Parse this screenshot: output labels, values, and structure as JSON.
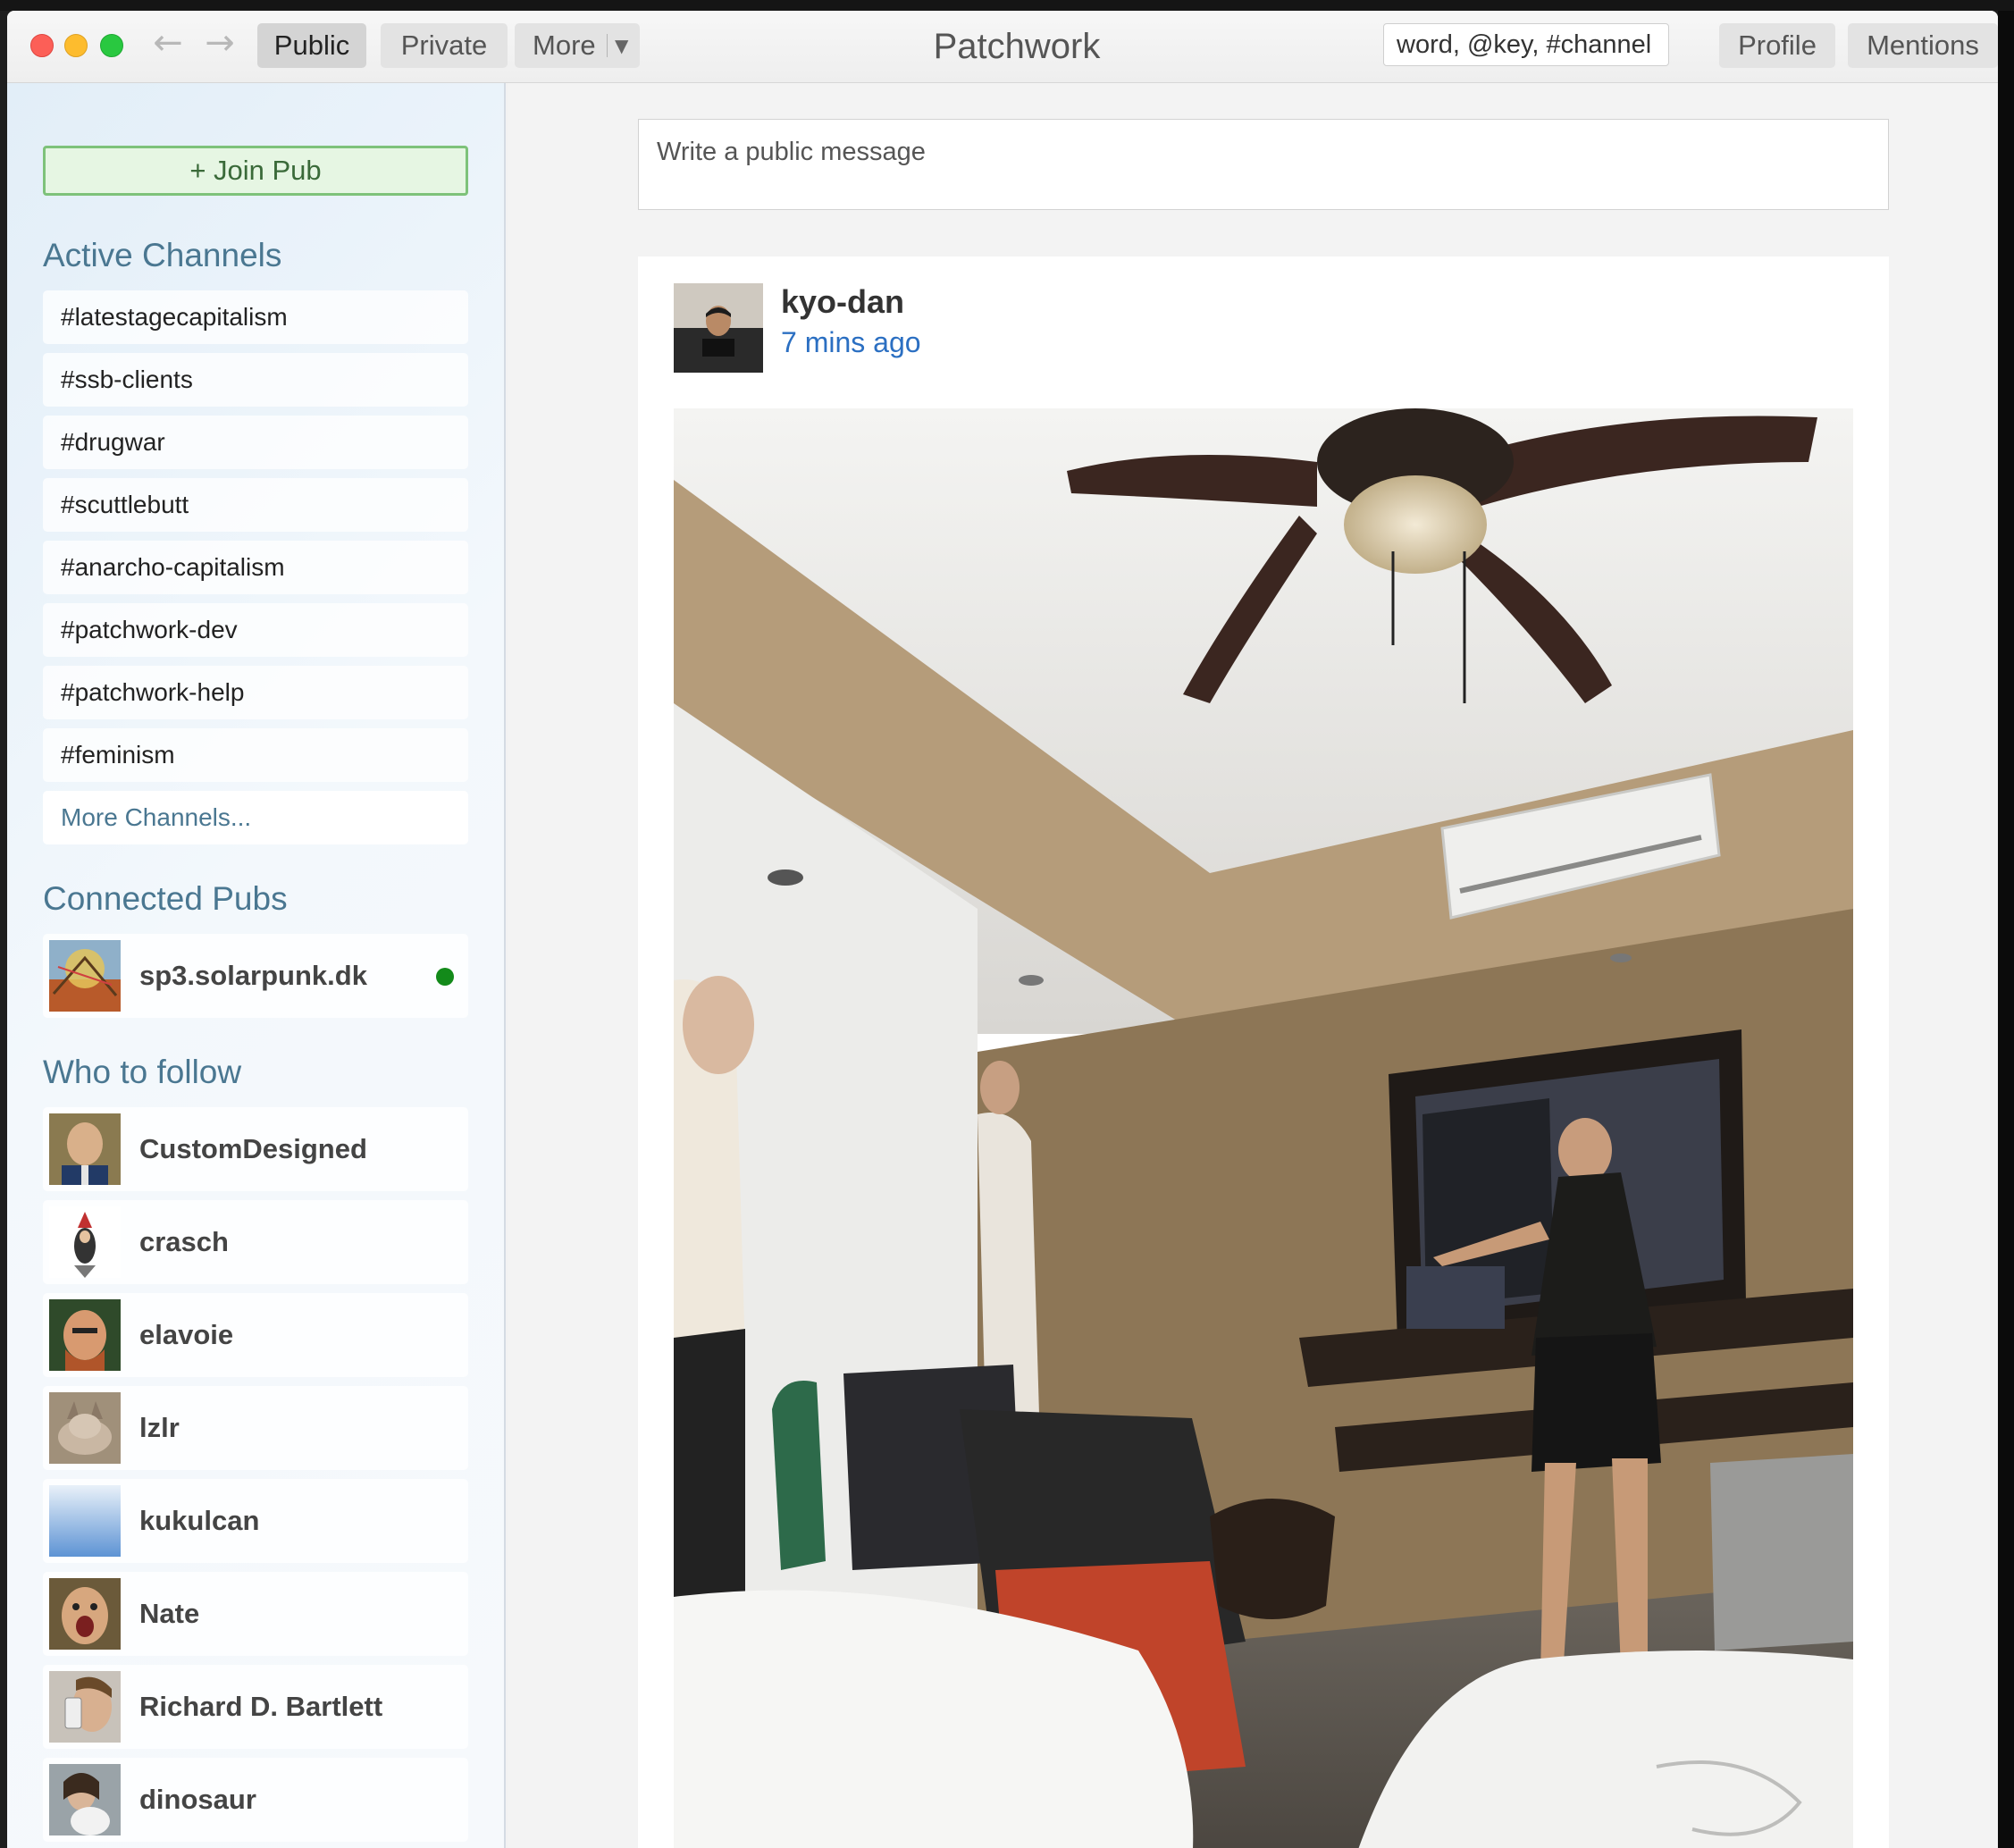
{
  "window": {
    "title": "Patchwork"
  },
  "toolbar": {
    "public_label": "Public",
    "private_label": "Private",
    "more_label": "More",
    "search_placeholder": "word, @key, #channel",
    "profile_label": "Profile",
    "mentions_label": "Mentions"
  },
  "sidebar": {
    "join_pub_label": "+ Join Pub",
    "active_channels_title": "Active Channels",
    "channels": [
      "#latestagecapitalism",
      "#ssb-clients",
      "#drugwar",
      "#scuttlebutt",
      "#anarcho-capitalism",
      "#patchwork-dev",
      "#patchwork-help",
      "#feminism"
    ],
    "more_channels_label": "More Channels...",
    "connected_pubs_title": "Connected Pubs",
    "pubs": [
      {
        "name": "sp3.solarpunk.dk",
        "status_color": "#138a1a"
      }
    ],
    "who_to_follow_title": "Who to follow",
    "suggestions": [
      "CustomDesigned",
      "crasch",
      "elavoie",
      "lzlr",
      "kukulcan",
      "Nate",
      "Richard D. Bartlett",
      "dinosaur"
    ]
  },
  "main": {
    "compose_placeholder": "Write a public message",
    "post": {
      "author": "kyo-dan",
      "time": "7 mins ago"
    }
  }
}
